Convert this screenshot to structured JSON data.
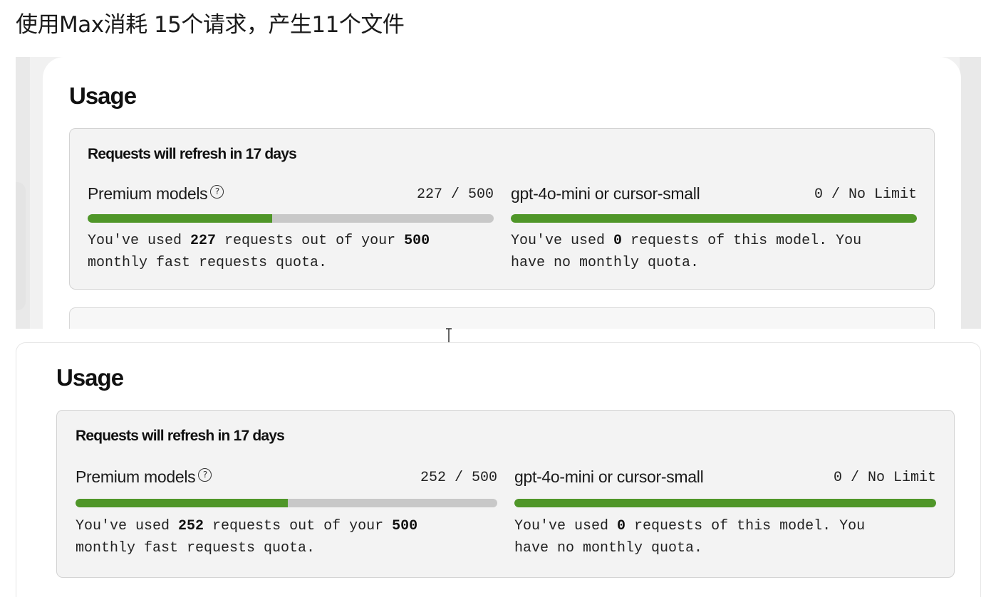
{
  "caption": "使用Max消耗 15个请求，产生11个文件",
  "shots": [
    {
      "title": "Usage",
      "card_heading": "Requests will refresh in 17 days",
      "premium": {
        "label": "Premium models",
        "help_icon": "question-circle-icon",
        "count": "227 / 500",
        "progress_fraction": 0.454,
        "desc_pre": "You've used ",
        "desc_used": "227",
        "desc_mid": " requests out of your ",
        "desc_quota": "500",
        "desc_line2": "monthly fast requests quota."
      },
      "small": {
        "label": "gpt-4o-mini or cursor-small",
        "count": "0 / No Limit",
        "progress_fraction": 1.0,
        "desc_pre": "You've used ",
        "desc_used": "0",
        "desc_mid": " requests of this model. You",
        "desc_line2": "have no monthly quota."
      }
    },
    {
      "title": "Usage",
      "card_heading": "Requests will refresh in 17 days",
      "premium": {
        "label": "Premium models",
        "help_icon": "question-circle-icon",
        "count": "252 / 500",
        "progress_fraction": 0.504,
        "desc_pre": "You've used ",
        "desc_used": "252",
        "desc_mid": " requests out of your ",
        "desc_quota": "500",
        "desc_line2": "monthly fast requests quota."
      },
      "small": {
        "label": "gpt-4o-mini or cursor-small",
        "count": "0 / No Limit",
        "progress_fraction": 1.0,
        "desc_pre": "You've used ",
        "desc_used": "0",
        "desc_mid": " requests of this model. You",
        "desc_line2": "have no monthly quota."
      }
    }
  ],
  "colors": {
    "progress_fill": "#4f9628",
    "progress_track": "#c8c8c8",
    "card_bg": "#f3f3f3"
  }
}
